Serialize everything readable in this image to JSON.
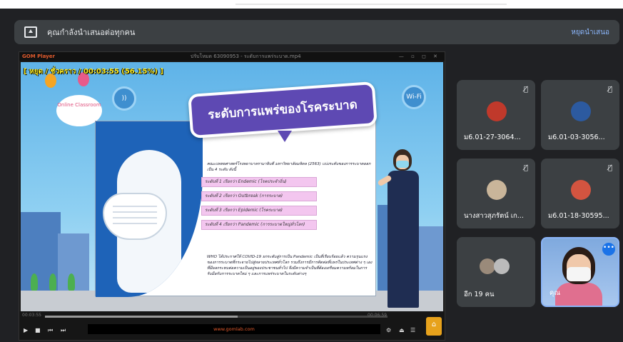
{
  "banner": {
    "text": "คุณกำลังนำเสนอต่อทุกคน",
    "stop_label": "หยุดนำเสนอ",
    "icon": "present-to-all-icon"
  },
  "player": {
    "app_name": "GOM Player",
    "window_title": "ปรับโหมด 63090953 - ระดับการแพร่ระบาด.mp4",
    "window_controls": "— ▫ ◻ ✕",
    "timecode_overlay": "[ หยุด / ชั่วคราว / 00:03:55 (56.15%) ]",
    "elapsed": "00:03:55",
    "duration": "00:06:59",
    "progress_percent": 56.15,
    "footer_brand": "www.gomlab.com"
  },
  "slide": {
    "title": "ระดับการแพร่ของโรคระบาด",
    "badge_online": "Online Classroom",
    "wifi_label": "Wi-Fi",
    "intro": "คณะแพทยศาสตร์โรงพยาบาลรามาธิบดี มหาวิทยาลัยมหิดล (2563) แบ่งระดับของการระบาดออกเป็น 4 ระดับ ดังนี้",
    "levels": [
      "ระดับที่ 1 เรียกว่า Endemic (โรคประจำถิ่น)",
      "ระดับที่ 2 เรียกว่า Outbreak (การระบาด)",
      "ระดับที่ 3 เรียกว่า Epidemic (โรคระบาด)",
      "ระดับที่ 4 เรียกว่า Pandemic (การระบาดใหญ่ทั่วโลก)"
    ],
    "outro": "WHO ได้ประกาศให้ COVID-19 ยกระดับสู่การเป็น Pandemic เป็นที่เรียบร้อยแล้ว ความรุนแรงของการระบาดที่กระจายไปสู่หลายประเทศทั่วโลก รวมถึงการมีการติดต่อที่แพร่ในประเทศต่าง ๆ เอง ที่มีผลกระทบต่อความเป็นอยู่ของประชาชนทั่วไป จึงมีความจำเป็นที่ต้องเตรียมความพร้อมในการรับมือกับการระบาดใหม่ ๆ และการแพร่ระบาดในระดับต่างๆ"
  },
  "participants": [
    {
      "name": "ม6.01-27-3064...",
      "muted": true,
      "avatar_color": "#c0392b"
    },
    {
      "name": "ม6.01-03-3056...",
      "muted": true,
      "avatar_color": "#2c5aa0"
    },
    {
      "name": "นางสาวสุภรัตน์ เก...",
      "muted": true,
      "avatar_color": "#c9b59a"
    },
    {
      "name": "ม6.01-18-30595...",
      "muted": true,
      "avatar_color": "#d35440"
    },
    {
      "name": "อีก 19 คน",
      "muted": false,
      "avatar_color": "#9a8a7a"
    },
    {
      "name": "คุณ",
      "muted": false,
      "avatar_color": "#e06f8f"
    }
  ],
  "icons": {
    "mute": "mic-off-icon",
    "more": "more-options-icon",
    "home": "home-icon"
  },
  "colors": {
    "meet_bg": "#202124",
    "tile_bg": "#3c4043",
    "accent": "#8ab4f8",
    "slide_title_bg": "#5e49b3",
    "level_highlight": "#f3c6ef"
  }
}
